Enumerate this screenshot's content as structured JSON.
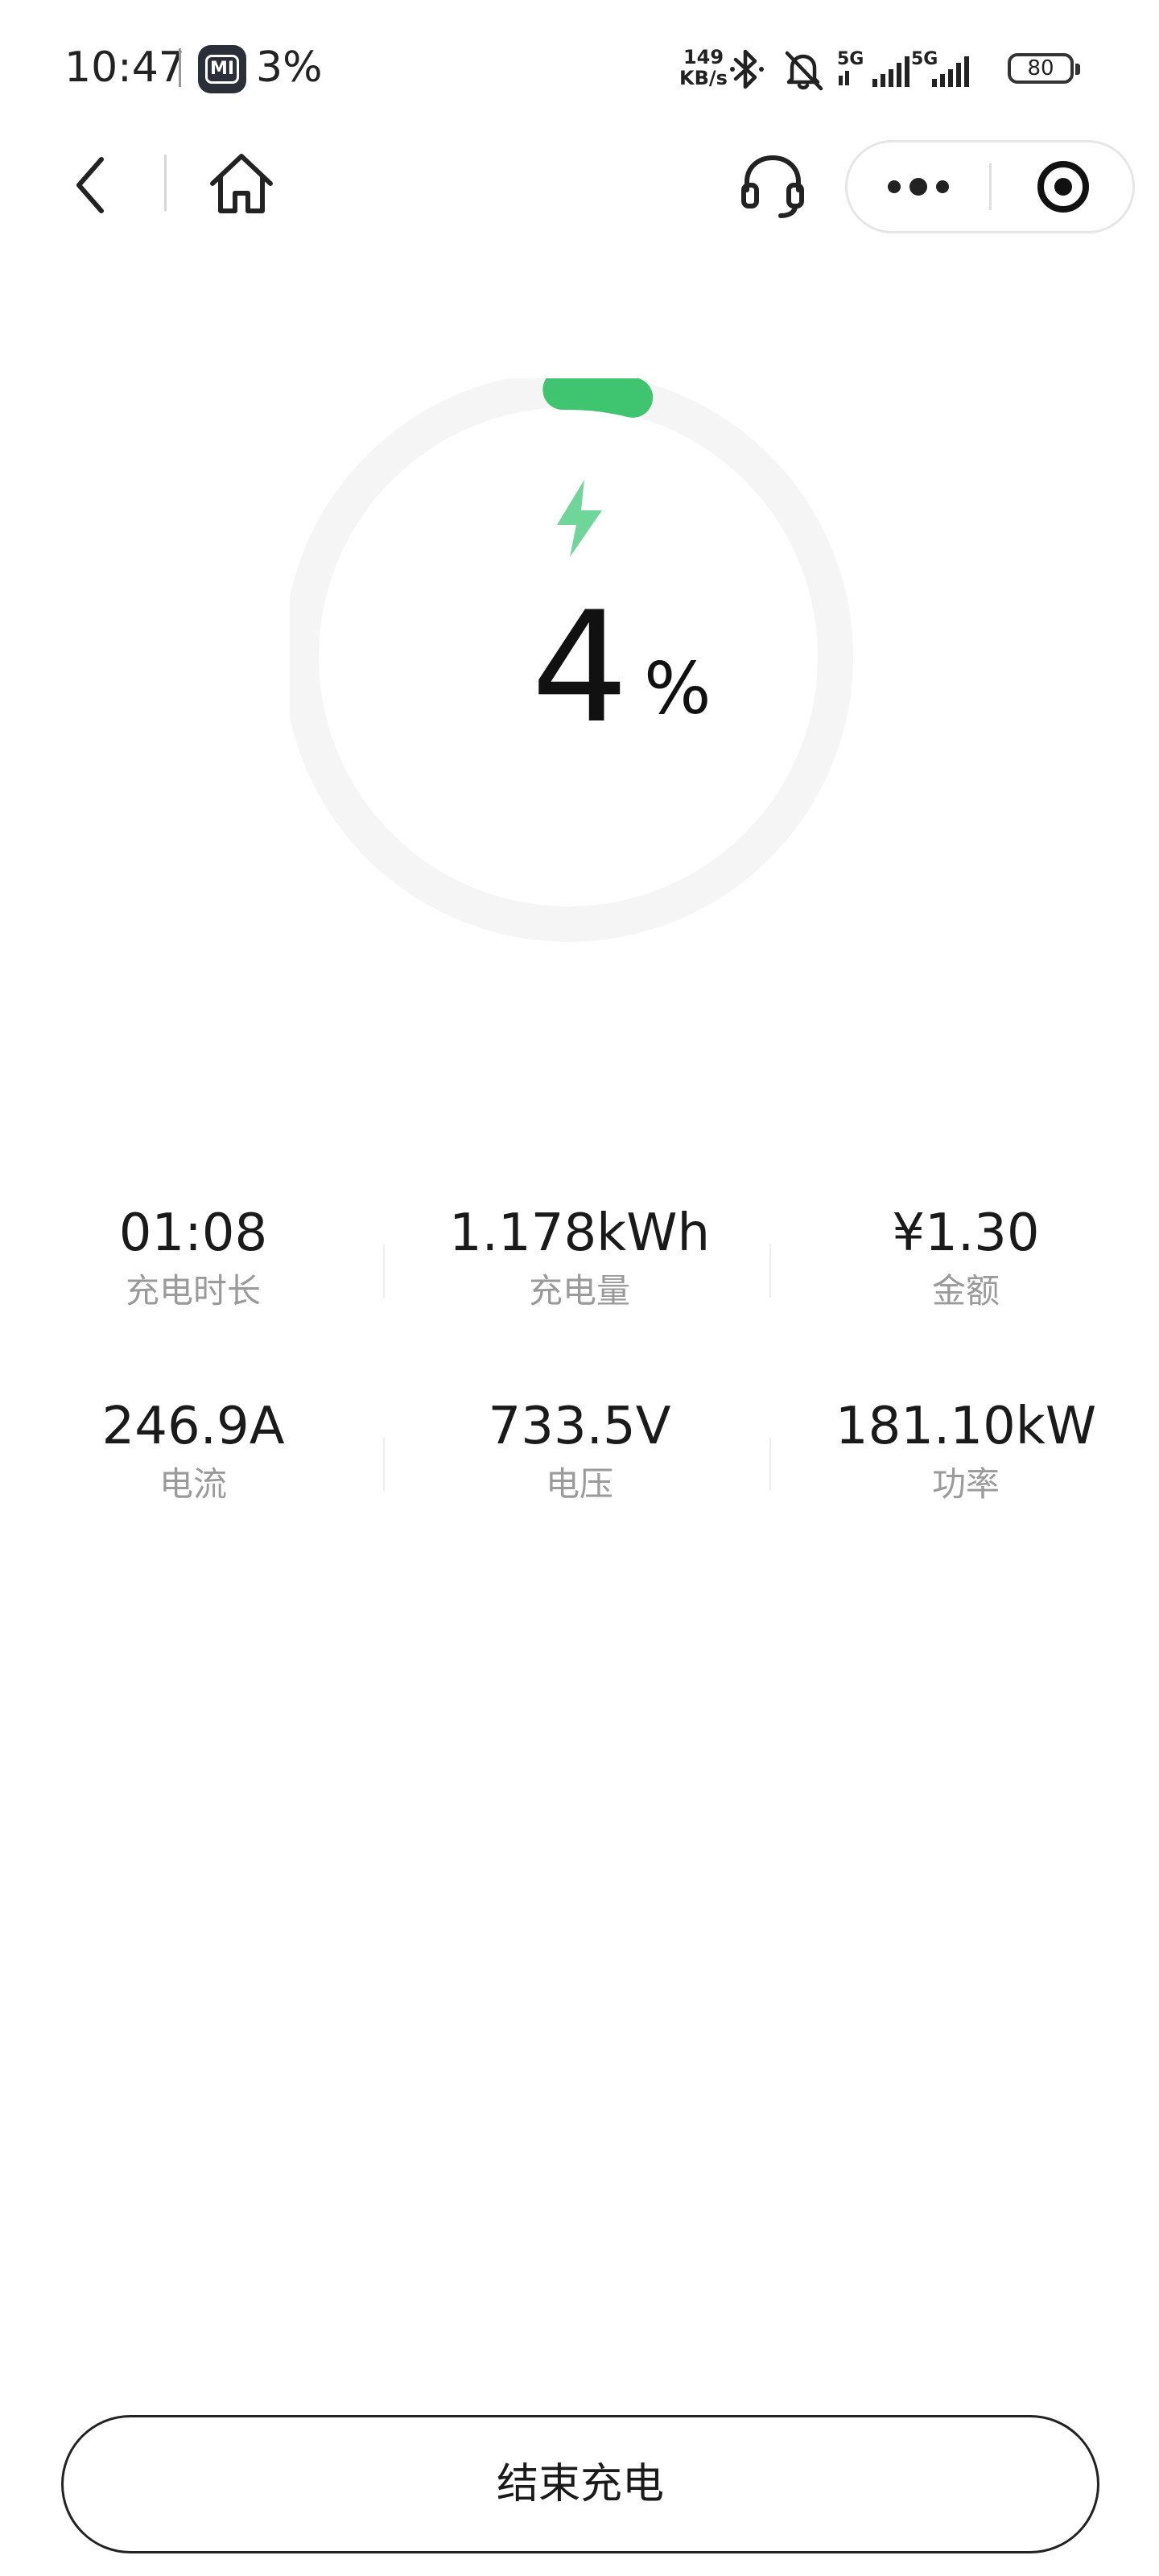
{
  "status_bar": {
    "time": "10:47",
    "app_icon_label": "MI",
    "app_battery": "3%",
    "net_speed_value": "149",
    "net_speed_unit": "KB/s",
    "network_1": "5G",
    "network_2": "5G",
    "battery_level": "80",
    "icons": [
      "bluetooth-icon",
      "mute-bell-icon",
      "signal-icon",
      "battery-icon"
    ]
  },
  "nav": {
    "icons": [
      "back-icon",
      "home-icon",
      "headset-icon",
      "more-icon",
      "target-icon"
    ]
  },
  "gauge": {
    "value": "4",
    "unit": "%",
    "progress": 0.04,
    "accent_color": "#3fc46f",
    "track_color": "#f5f5f5",
    "bolt_color": "#6fd69a"
  },
  "stats": [
    [
      {
        "value": "01:08",
        "label": "充电时长"
      },
      {
        "value": "1.178kWh",
        "label": "充电量"
      },
      {
        "value": "¥1.30",
        "label": "金额"
      }
    ],
    [
      {
        "value": "246.9A",
        "label": "电流"
      },
      {
        "value": "733.5V",
        "label": "电压"
      },
      {
        "value": "181.10kW",
        "label": "功率"
      }
    ]
  ],
  "action": {
    "end_charging": "结束充电"
  }
}
